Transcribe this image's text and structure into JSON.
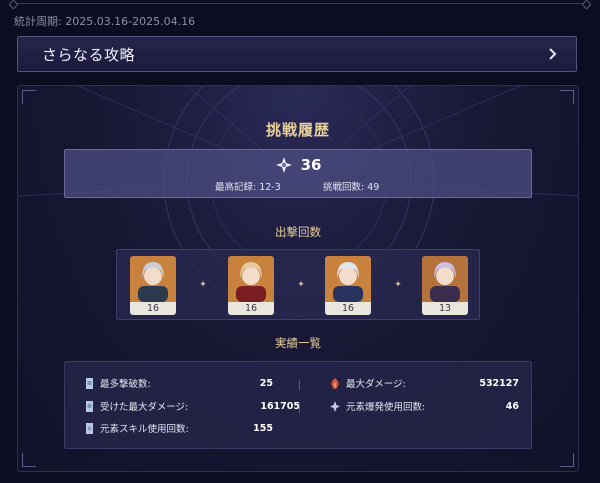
{
  "period": "統計周期: 2025.03.16-2025.04.16",
  "more_strategies": {
    "label": "さらなる攻略"
  },
  "challenge": {
    "title": "挑戦履歴",
    "stars": "36",
    "best_record": "最高記録: 12-3",
    "attempts": "挑戦回数: 49"
  },
  "sortie": {
    "title": "出撃回数",
    "characters": [
      {
        "count": "16",
        "hair": "#c9cdd6",
        "clothes": "#2c3a4e",
        "bg": "#c8823e"
      },
      {
        "count": "16",
        "hair": "#e8c9a0",
        "clothes": "#7a1e22",
        "bg": "#c8823e"
      },
      {
        "count": "16",
        "hair": "#dfe6f2",
        "clothes": "#27325e",
        "bg": "#c8823e"
      },
      {
        "count": "13",
        "hair": "#cdbde4",
        "clothes": "#3a2c4c",
        "bg": "#b5723a"
      }
    ],
    "separator": "✦"
  },
  "achievements": {
    "title": "実績一覧",
    "stats": [
      {
        "label": "最多撃破数:",
        "value": "25",
        "icon": "defeat-icon"
      },
      {
        "label": "受けた最大ダメージ:",
        "value": "161705",
        "icon": "damage-taken-icon"
      },
      {
        "label": "元素スキル使用回数:",
        "value": "155",
        "icon": "skill-icon"
      },
      {
        "label": "最大ダメージ:",
        "value": "532127",
        "icon": "max-damage-icon"
      },
      {
        "label": "元素爆発使用回数:",
        "value": "46",
        "icon": "burst-icon"
      }
    ]
  },
  "colors": {
    "accent_gold": "#e9cf9a",
    "panel": "#181836",
    "count_bg": "#e9e6dd"
  }
}
